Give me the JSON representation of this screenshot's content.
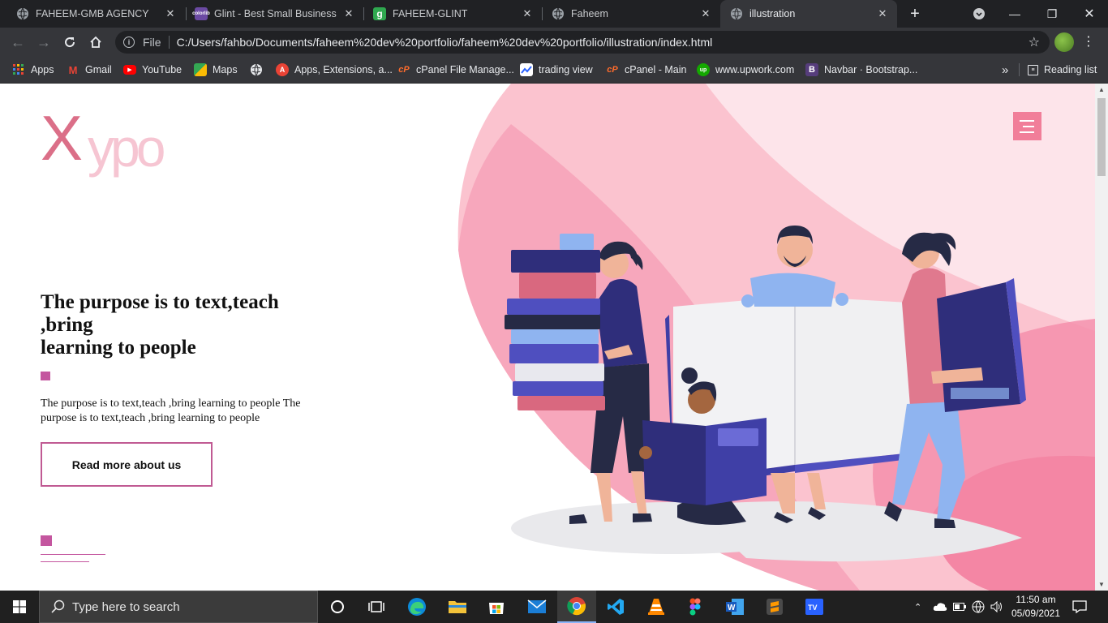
{
  "browser": {
    "tabs": [
      {
        "title": "FAHEEM-GMB AGENCY",
        "icon": "globe-icon"
      },
      {
        "title": "Glint - Best Small Business W",
        "icon": "colorlib-icon"
      },
      {
        "title": "FAHEEM-GLINT",
        "icon": "glint-g-icon"
      },
      {
        "title": "Faheem",
        "icon": "globe-icon"
      },
      {
        "title": "illustration",
        "icon": "globe-icon",
        "active": true
      }
    ],
    "new_tab_label": "+",
    "address": {
      "scheme_label": "File",
      "url": "C:/Users/fahbo/Documents/faheem%20dev%20portfolio/faheem%20dev%20portfolio/illustration/index.html"
    },
    "bookmarks": [
      {
        "label": "Apps",
        "icon": "apps-grid-icon"
      },
      {
        "label": "Gmail",
        "icon": "gmail-icon"
      },
      {
        "label": "YouTube",
        "icon": "youtube-icon"
      },
      {
        "label": "Maps",
        "icon": "maps-icon"
      },
      {
        "label": "",
        "icon": "globe-icon"
      },
      {
        "label": "Apps, Extensions, a...",
        "icon": "extensions-icon"
      },
      {
        "label": "cPanel File Manage...",
        "icon": "cpanel-icon"
      },
      {
        "label": "trading view",
        "icon": "tradingview-icon"
      },
      {
        "label": "cPanel - Main",
        "icon": "cpanel-icon"
      },
      {
        "label": "www.upwork.com",
        "icon": "upwork-icon"
      },
      {
        "label": "Navbar · Bootstrap...",
        "icon": "bootstrap-icon"
      }
    ],
    "more_bookmarks": "»",
    "reading_list": "Reading list"
  },
  "page": {
    "logo": {
      "first": "X",
      "rest": "ypo"
    },
    "hero": {
      "title_lines": [
        "The purpose is to text,teach",
        ",bring",
        "learning to people"
      ],
      "paragraph": "The purpose is to text,teach ,bring learning to people The purpose is to text,teach ,bring learning to people",
      "cta_label": "Read more about us"
    },
    "colors": {
      "accent": "#c4569f",
      "pink": "#f17e99",
      "logo_dark": "#db6f88",
      "logo_light": "#f6c5d2",
      "navy": "#2f2e7b"
    }
  },
  "taskbar": {
    "search_placeholder": "Type here to search",
    "apps": [
      "task-view-icon",
      "cortana-circle-icon",
      "edge-icon",
      "file-explorer-icon",
      "store-icon",
      "mail-icon",
      "chrome-icon",
      "vscode-icon",
      "vlc-icon",
      "figma-icon",
      "word-icon",
      "sublime-icon",
      "app-icon"
    ],
    "clock": {
      "time": "11:50 am",
      "date": "05/09/2021"
    }
  }
}
